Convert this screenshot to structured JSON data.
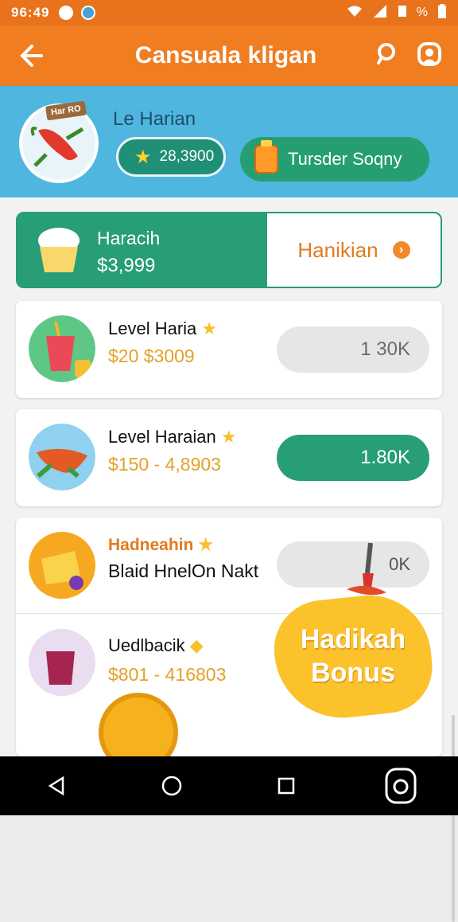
{
  "status_bar": {
    "time": "96:49",
    "battery": "%"
  },
  "app_bar": {
    "title": "Cansuala kligan"
  },
  "header": {
    "avatar_tag": "Har RO",
    "user_name": "Le Harian",
    "coins": "28,3900",
    "store_label": "Tursder Soqny"
  },
  "feature": {
    "title": "Haracih",
    "price": "$3,999",
    "claim_label": "Hanikian"
  },
  "items": [
    {
      "name": "Level Haria",
      "price": "$20 $3009",
      "button": "1   30K",
      "button_state": "inactive"
    },
    {
      "name": "Level Haraian",
      "price": "$150 - 4,8903",
      "button": "1.80K",
      "button_state": "active"
    }
  ],
  "bottom_card": {
    "name": "Hadneahin",
    "subtitle": "Blaid HnelOn Nakt",
    "button": "0K",
    "name2": "Uedlbacik",
    "price2": "$801 - 416803"
  },
  "bonus": {
    "line1": "Hadikah",
    "line2": "Bonus"
  },
  "colors": {
    "orange": "#f07d20",
    "blue": "#4fb6df",
    "green": "#279e76",
    "gold": "#e3a12a"
  }
}
